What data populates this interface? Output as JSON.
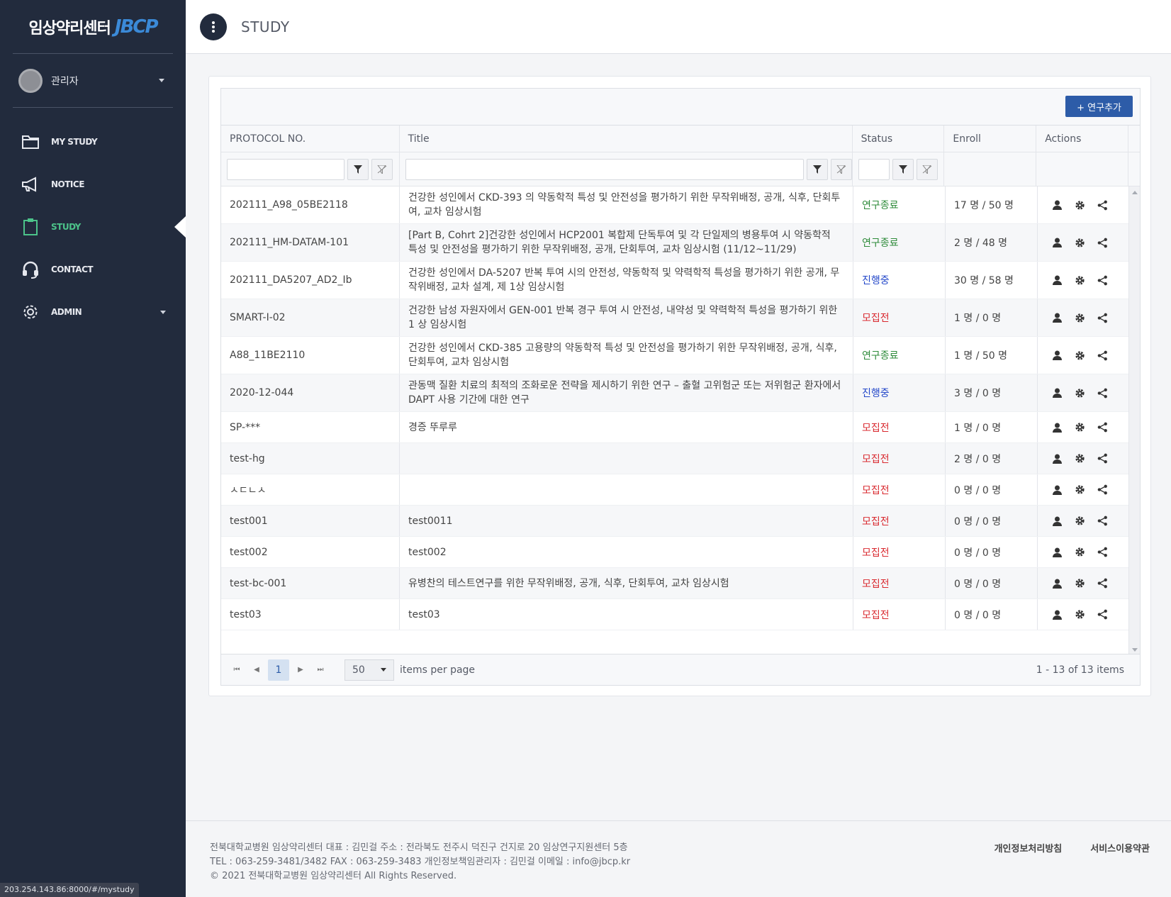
{
  "brand": {
    "text": "임상약리센터",
    "logo": "JBCP"
  },
  "user": {
    "name": "관리자"
  },
  "nav": [
    {
      "label": "MY STUDY",
      "icon": "folder-icon"
    },
    {
      "label": "NOTICE",
      "icon": "megaphone-icon"
    },
    {
      "label": "STUDY",
      "icon": "clipboard-icon",
      "active": true
    },
    {
      "label": "CONTACT",
      "icon": "headset-icon"
    },
    {
      "label": "ADMIN",
      "icon": "gear-icon"
    }
  ],
  "url_tooltip": "203.254.143.86:8000/#/mystudy",
  "header": {
    "title": "STUDY"
  },
  "toolbar": {
    "add_label": "+ 연구추가"
  },
  "columns": {
    "protocol": "PROTOCOL NO.",
    "title": "Title",
    "status": "Status",
    "enroll": "Enroll",
    "actions": "Actions"
  },
  "rows": [
    {
      "protocol": "202111_A98_05BE2118",
      "title": "건강한 성인에서 CKD-393 의 약동학적 특성 및 안전성을 평가하기 위한 무작위배정, 공개, 식후, 단회투여, 교차 임상시험",
      "status": "연구종료",
      "status_type": "done",
      "enroll": "17 명 / 50 명"
    },
    {
      "protocol": "202111_HM-DATAM-101",
      "title": "[Part B, Cohrt 2]건강한 성인에서 HCP2001 복합제 단독투여 및 각 단일제의 병용투여 시 약동학적 특성 및 안전성을 평가하기 위한 무작위배정, 공개, 단회투여, 교차 임상시험 (11/12~11/29)",
      "status": "연구종료",
      "status_type": "done",
      "enroll": "2 명 / 48 명"
    },
    {
      "protocol": "202111_DA5207_AD2_Ib",
      "title": "건강한 성인에서 DA-5207 반복 투여 시의 안전성, 약동학적 및 약력학적 특성을 평가하기 위한 공개, 무작위배정, 교차 설계, 제 1상 임상시험",
      "status": "진행중",
      "status_type": "prog",
      "enroll": "30 명 / 58 명"
    },
    {
      "protocol": "SMART-I-02",
      "title": "건강한 남성 자원자에서 GEN-001 반복 경구 투여 시 안전성, 내약성 및 약력학적 특성을 평가하기 위한 1 상 임상시험",
      "status": "모집전",
      "status_type": "pre",
      "enroll": "1 명 / 0 명"
    },
    {
      "protocol": "A88_11BE2110",
      "title": "건강한 성인에서 CKD-385 고용량의 약동학적 특성 및 안전성을 평가하기 위한 무작위배정, 공개, 식후, 단회투여, 교차 임상시험",
      "status": "연구종료",
      "status_type": "done",
      "enroll": "1 명 / 50 명"
    },
    {
      "protocol": "2020-12-044",
      "title": "관동맥 질환 치료의 최적의 조화로운 전략을 제시하기 위한 연구 – 출혈 고위험군 또는 저위험군 환자에서 DAPT 사용 기간에 대한 연구",
      "status": "진행중",
      "status_type": "prog",
      "enroll": "3 명 / 0 명"
    },
    {
      "protocol": "SP-***",
      "title": "경증 뚜루루",
      "status": "모집전",
      "status_type": "pre",
      "enroll": "1 명 / 0 명"
    },
    {
      "protocol": "test-hg",
      "title": "",
      "status": "모집전",
      "status_type": "pre",
      "enroll": "2 명 / 0 명"
    },
    {
      "protocol": "ㅅㄷㄴㅅ",
      "title": "",
      "status": "모집전",
      "status_type": "pre",
      "enroll": "0 명 / 0 명"
    },
    {
      "protocol": "test001",
      "title": "test0011",
      "status": "모집전",
      "status_type": "pre",
      "enroll": "0 명 / 0 명"
    },
    {
      "protocol": "test002",
      "title": "test002",
      "status": "모집전",
      "status_type": "pre",
      "enroll": "0 명 / 0 명"
    },
    {
      "protocol": "test-bc-001",
      "title": "유병찬의 테스트연구를 위한 무작위배정, 공개, 식후, 단회투여, 교차 임상시험",
      "status": "모집전",
      "status_type": "pre",
      "enroll": "0 명 / 0 명"
    },
    {
      "protocol": "test03",
      "title": "test03",
      "status": "모집전",
      "status_type": "pre",
      "enroll": "0 명 / 0 명"
    }
  ],
  "pager": {
    "current_page": "1",
    "page_size": "50",
    "items_per_page_label": "items per page",
    "info": "1 - 13 of 13 items"
  },
  "footer": {
    "line1": "전북대학교병원 임상약리센터 대표 : 김민걸 주소 : 전라북도 전주시 덕진구 건지로 20 임상연구지원센터 5층",
    "line2": "TEL : 063-259-3481/3482 FAX : 063-259-3483 개인정보책임관리자 : 김민걸 이메일 : info@jbcp.kr",
    "line3": "© 2021 전북대학교병원 임상약리센터 All Rights Reserved.",
    "privacy": "개인정보처리방침",
    "terms": "서비스이용약관"
  },
  "colors": {
    "sidebar": "#222b3d",
    "accent": "#2d5ca8",
    "active_nav": "#4cc38a",
    "status_done": "#2e8b3a",
    "status_progress": "#2347c9",
    "status_pre": "#d9292f"
  }
}
